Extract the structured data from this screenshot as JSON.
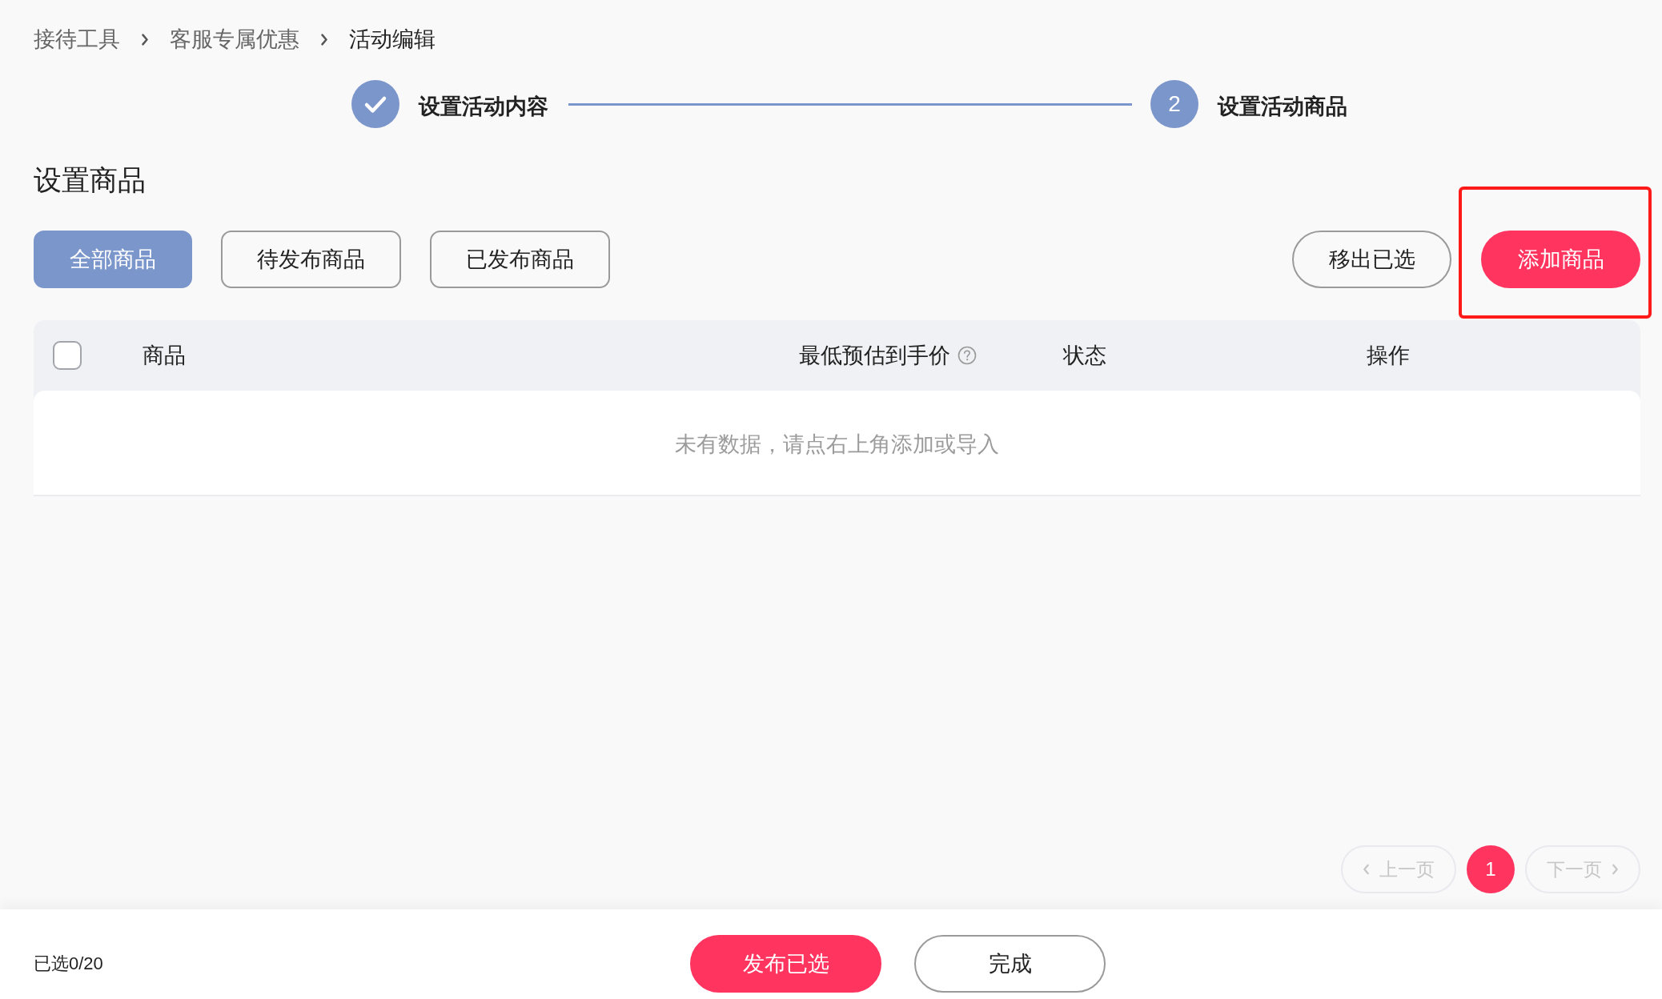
{
  "breadcrumb": [
    {
      "label": "接待工具",
      "current": false
    },
    {
      "label": "客服专属优惠",
      "current": false
    },
    {
      "label": "活动编辑",
      "current": true
    }
  ],
  "steps": [
    {
      "label": "设置活动内容",
      "completed": true
    },
    {
      "label": "设置活动商品",
      "completed": false,
      "number": "2"
    }
  ],
  "section_title": "设置商品",
  "filter_tabs": [
    {
      "label": "全部商品",
      "selected": true
    },
    {
      "label": "待发布商品",
      "selected": false
    },
    {
      "label": "已发布商品",
      "selected": false
    }
  ],
  "actions": [
    {
      "label": "移出已选",
      "kind": "outline",
      "highlighted": false
    },
    {
      "label": "添加商品",
      "kind": "primary",
      "highlighted": true
    }
  ],
  "table": {
    "select_all": {
      "checked": false
    },
    "columns": [
      {
        "label": "商品",
        "help": false
      },
      {
        "label": "最低预估到手价",
        "help": true
      },
      {
        "label": "状态",
        "help": false
      },
      {
        "label": "操作",
        "help": false
      }
    ],
    "empty_text": "未有数据，请点右上角添加或导入"
  },
  "pagination": {
    "prev": {
      "label": "上一页",
      "disabled": true
    },
    "pages": [
      {
        "label": "1",
        "selected": true
      }
    ],
    "next": {
      "label": "下一页",
      "disabled": true
    }
  },
  "footer": {
    "selected_count": "已选0/20",
    "buttons": [
      {
        "label": "发布已选",
        "kind": "primary"
      },
      {
        "label": "完成",
        "kind": "outline"
      }
    ]
  }
}
